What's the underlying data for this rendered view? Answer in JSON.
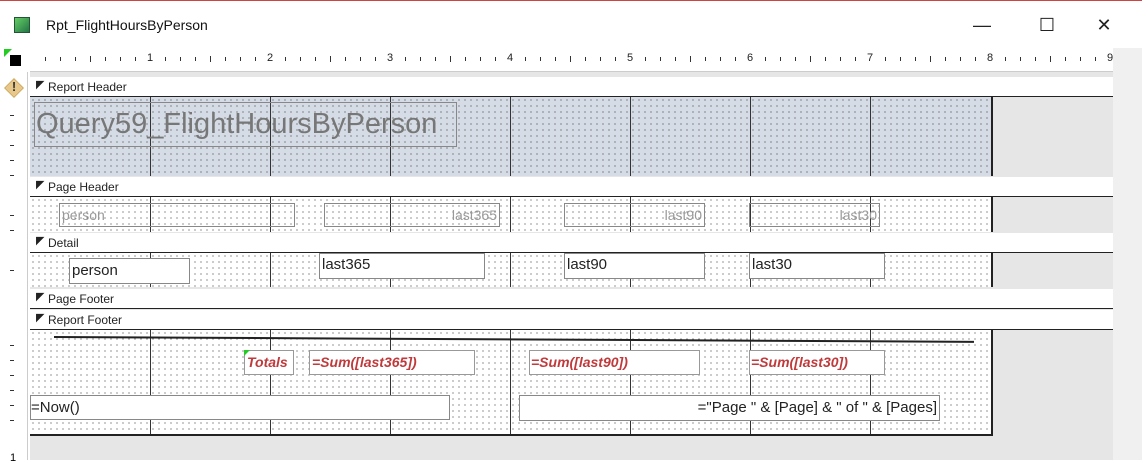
{
  "window": {
    "title": "Rpt_FlightHoursByPerson",
    "minimize": "—",
    "maximize": "☐",
    "close": "✕"
  },
  "ruler": {
    "numbers": [
      "1",
      "2",
      "3",
      "4",
      "5",
      "6",
      "7",
      "8",
      "9"
    ]
  },
  "left_ruler": {
    "number": "1"
  },
  "sections": {
    "report_header": "Report Header",
    "page_header": "Page Header",
    "detail": "Detail",
    "page_footer": "Page Footer",
    "report_footer": "Report Footer"
  },
  "report_header": {
    "title": "Query59_FlightHoursByPerson"
  },
  "page_header": {
    "labels": [
      "person",
      "last365",
      "last90",
      "last30"
    ]
  },
  "detail": {
    "fields": [
      "person",
      "last365",
      "last90",
      "last30"
    ]
  },
  "report_footer": {
    "totals_label": "Totals",
    "sum365": "=Sum([last365])",
    "sum90": "=Sum([last90])",
    "sum30": "=Sum([last30])",
    "now": "=Now()",
    "page": "=\"Page \" & [Page] & \" of \" & [Pages]"
  },
  "colors": {
    "totals": "#c0393b",
    "header_bg": "#d5dce6"
  }
}
